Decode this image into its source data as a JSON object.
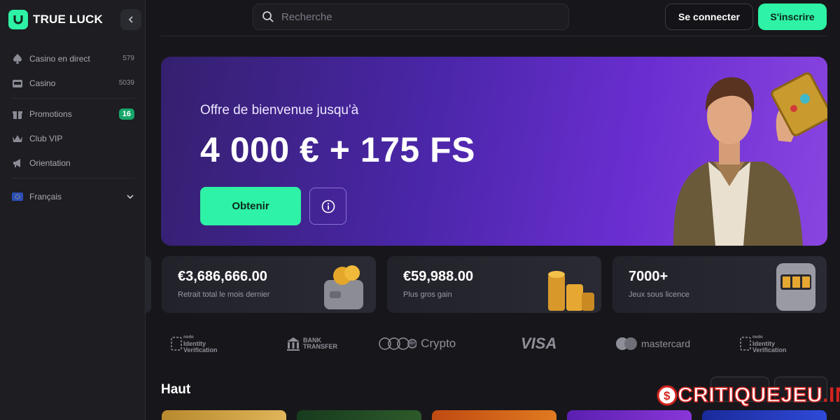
{
  "brand": {
    "name": "TRUE LUCK"
  },
  "sidebar": {
    "items": [
      {
        "label": "Casino en direct",
        "count": "579",
        "icon": "live-casino-icon"
      },
      {
        "label": "Casino",
        "count": "5039",
        "icon": "slot-machine-icon"
      },
      {
        "label": "Promotions",
        "badge": "16",
        "icon": "gift-icon"
      },
      {
        "label": "Club VIP",
        "icon": "crown-icon"
      },
      {
        "label": "Orientation",
        "icon": "megaphone-icon"
      }
    ],
    "language": {
      "label": "Français",
      "icon": "eu-flag-icon"
    }
  },
  "header": {
    "search_placeholder": "Recherche",
    "login_label": "Se connecter",
    "register_label": "S'inscrire"
  },
  "hero": {
    "subtitle": "Offre de bienvenue jusqu'à",
    "title": "4 000 € + 175 FS",
    "cta_label": "Obtenir"
  },
  "stats": [
    {
      "value": "€3,686,666.00",
      "label": "Retrait total le mois dernier"
    },
    {
      "value": "€59,988.00",
      "label": "Plus gros gain"
    },
    {
      "value": "7000+",
      "label": "Jeux sous licence"
    }
  ],
  "payments": {
    "identity_small": "nodo",
    "identity_line1": "Identity",
    "identity_line2": "Verification",
    "bank_line1": "BANK",
    "bank_line2": "TRANSFER",
    "crypto": "Crypto",
    "crypto_extra": "50+",
    "visa": "VISA",
    "mastercard": "mastercard"
  },
  "section": {
    "title": "Haut"
  },
  "watermark": {
    "part1": "CRITIQUEJEU",
    "part2": ".INFO"
  },
  "colors": {
    "accent": "#2ef2a5",
    "hero_start": "#34206e",
    "hero_end": "#8a45e0",
    "badge": "#16a66a",
    "watermark": "#d4241f"
  }
}
